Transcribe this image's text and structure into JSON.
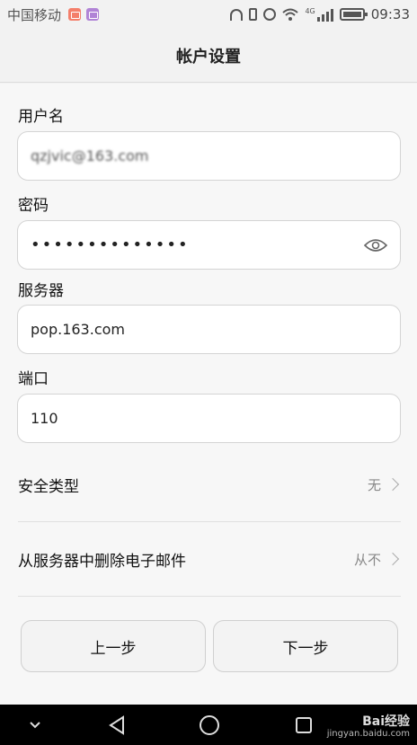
{
  "status_bar": {
    "carrier": "中国移动",
    "time": "09:33",
    "network_label": "4G",
    "icons": [
      "mail-notification-icon",
      "gallery-notification-icon",
      "headphone-icon",
      "vibrate-icon",
      "alarm-icon",
      "wifi-icon",
      "signal-icon",
      "battery-icon"
    ]
  },
  "header": {
    "title": "帐户设置"
  },
  "form": {
    "username_label": "用户名",
    "username_value": "qzjvic@163.com",
    "password_label": "密码",
    "password_value": "••••••••••••••",
    "server_label": "服务器",
    "server_value": "pop.163.com",
    "port_label": "端口",
    "port_value": "110"
  },
  "settings": {
    "security_label": "安全类型",
    "security_value": "无",
    "delete_label": "从服务器中删除电子邮件",
    "delete_value": "从不"
  },
  "buttons": {
    "prev": "上一步",
    "next": "下一步"
  },
  "nav": {
    "icons": [
      "chevron-down-icon",
      "back-icon",
      "home-icon",
      "recents-icon"
    ]
  },
  "watermark": {
    "brand": "Bai经验",
    "url": "jingyan.baidu.com"
  },
  "colors": {
    "background": "#f7f7f7",
    "field_border": "#d4d4d4",
    "nav_bar": "#000000"
  }
}
